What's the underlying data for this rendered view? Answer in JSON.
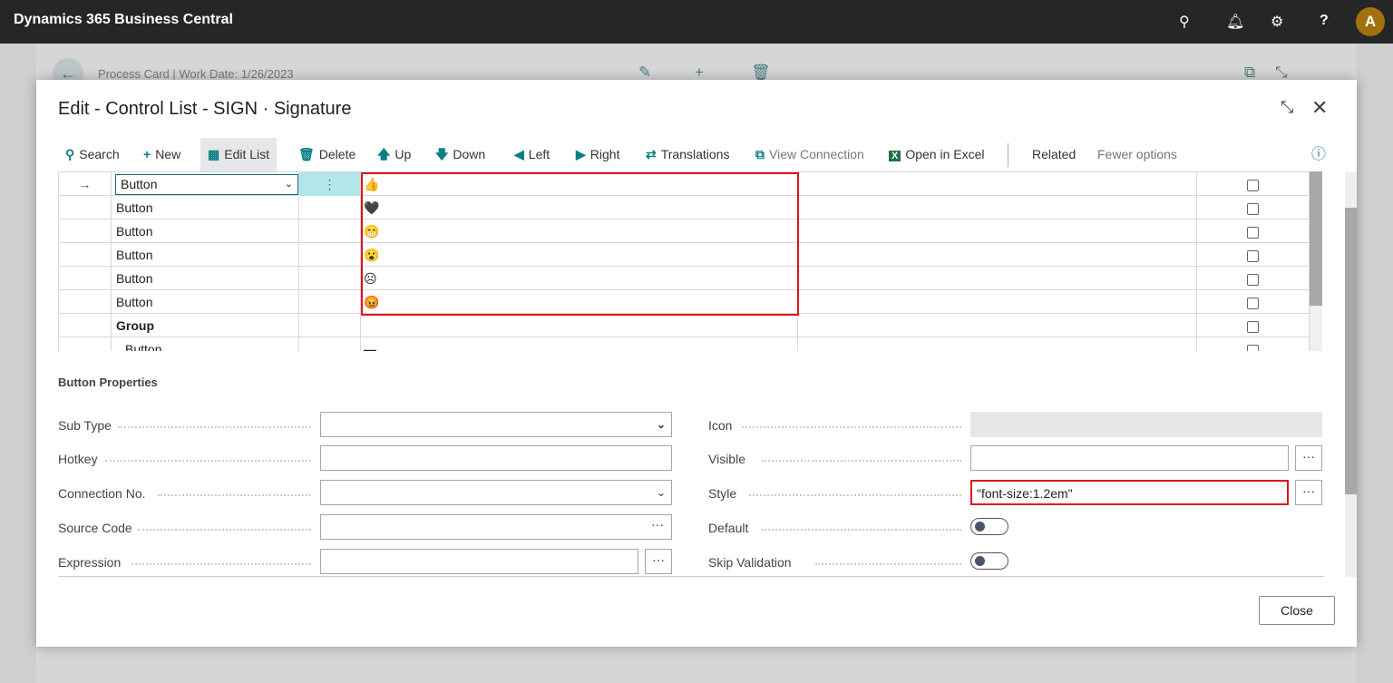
{
  "app": {
    "title": "Dynamics 365 Business Central",
    "avatar": "A",
    "icons": [
      "search-icon",
      "bell-icon",
      "gear-icon",
      "help-icon"
    ]
  },
  "background": {
    "breadcrumb": "Process Card | Work Date: 1/26/2023"
  },
  "dialog": {
    "title": "Edit - Control List - SIGN · Signature",
    "close_label": "Close"
  },
  "toolbar": [
    {
      "label": "Search",
      "icon": "⚲",
      "name": "search"
    },
    {
      "label": "New",
      "icon": "+",
      "name": "new"
    },
    {
      "label": "Edit List",
      "icon": "▦",
      "name": "edit-list",
      "active": true
    },
    {
      "label": "Delete",
      "icon": "🗑",
      "name": "delete"
    },
    {
      "label": "Up",
      "icon": "🡅",
      "name": "up"
    },
    {
      "label": "Down",
      "icon": "🡇",
      "name": "down"
    },
    {
      "label": "Left",
      "icon": "◀",
      "name": "left"
    },
    {
      "label": "Right",
      "icon": "▶",
      "name": "right"
    },
    {
      "label": "Translations",
      "icon": "⇄",
      "name": "translations"
    },
    {
      "label": "View Connection",
      "icon": "⧉",
      "name": "view-connection",
      "disabled": true
    },
    {
      "label": "Open in Excel",
      "icon": "X",
      "name": "open-in-excel"
    },
    {
      "label": "Related",
      "name": "related"
    },
    {
      "label": "Fewer options",
      "name": "fewer-options",
      "disabled": true
    }
  ],
  "grid": {
    "rows": [
      {
        "type": "Button",
        "icon": "👍",
        "selected": true,
        "checked": false
      },
      {
        "type": "Button",
        "icon": "🖤",
        "checked": false
      },
      {
        "type": "Button",
        "icon": "😁",
        "checked": false
      },
      {
        "type": "Button",
        "icon": "😮",
        "checked": false
      },
      {
        "type": "Button",
        "icon": "☹",
        "checked": false
      },
      {
        "type": "Button",
        "icon": "😡",
        "checked": false
      },
      {
        "type": "Group",
        "icon": "",
        "bold": true,
        "checked": false
      },
      {
        "type": "Button",
        "icon": "▬",
        "indent": true,
        "checked": false
      }
    ]
  },
  "properties": {
    "title": "Button Properties",
    "left": [
      {
        "label": "Sub Type",
        "value": "",
        "kind": "select"
      },
      {
        "label": "Hotkey",
        "value": "",
        "kind": "text"
      },
      {
        "label": "Connection No.",
        "value": "",
        "kind": "dropdown"
      },
      {
        "label": "Source Code",
        "value": "",
        "kind": "lookup"
      },
      {
        "label": "Expression",
        "value": "",
        "kind": "ellipsis"
      }
    ],
    "right": [
      {
        "label": "Icon",
        "value": "",
        "kind": "readonly"
      },
      {
        "label": "Visible",
        "value": "",
        "kind": "ellipsis"
      },
      {
        "label": "Style",
        "value": "\"font-size:1.2em\"",
        "kind": "ellipsis",
        "highlighted": true
      },
      {
        "label": "Default",
        "value": false,
        "kind": "toggle"
      },
      {
        "label": "Skip Validation",
        "value": false,
        "kind": "toggle"
      }
    ]
  },
  "colors": {
    "accent": "#0a7f86",
    "highlight": "#e0131b",
    "topbar": "#262626"
  }
}
